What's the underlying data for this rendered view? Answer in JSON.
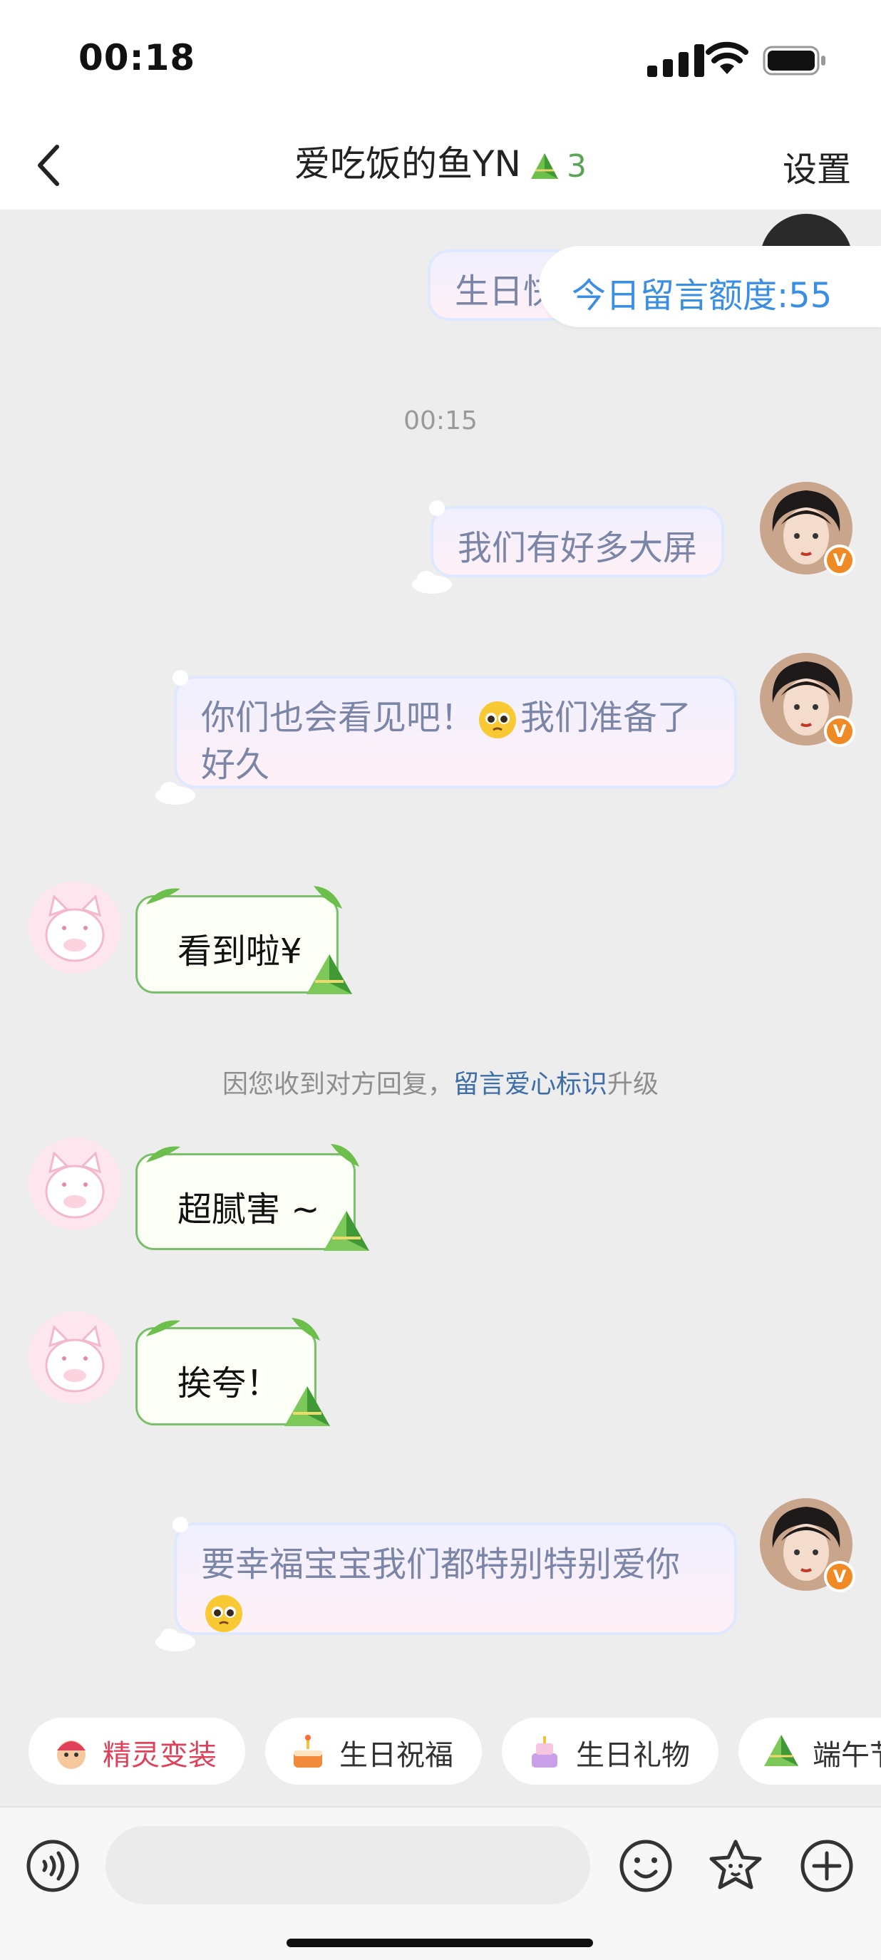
{
  "status": {
    "time": "00:18"
  },
  "nav": {
    "title": "爱吃饭的鱼YN",
    "badge_count": "3",
    "settings": "设置"
  },
  "quota": "今日留言额度:55",
  "messages": {
    "m0": "生日快",
    "t1": "00:15",
    "m1": "我们有好多大屏",
    "m2a": "你们也会看见吧！",
    "m2b": "我们准备了好久",
    "r1": "看到啦¥",
    "note_pre": "因您收到对方回复，",
    "note_link": "留言爱心标识",
    "note_post": "升级",
    "r2": "超腻害 ~",
    "r3": "挨夸！",
    "m3": "要幸福宝宝我们都特别特别爱你"
  },
  "chips": [
    "精灵变装",
    "生日祝福",
    "生日礼物",
    "端午节"
  ],
  "icons": {
    "verified": "V",
    "emoji": "pleading-face-emoji",
    "chip_icons": [
      "genie-icon",
      "cake-icon",
      "birthday-cake-icon",
      "zongzi-icon"
    ]
  },
  "colors": {
    "accent_blue": "#3b8fe3",
    "leaf_green": "#5aa455",
    "chip_red": "#e0405a"
  }
}
